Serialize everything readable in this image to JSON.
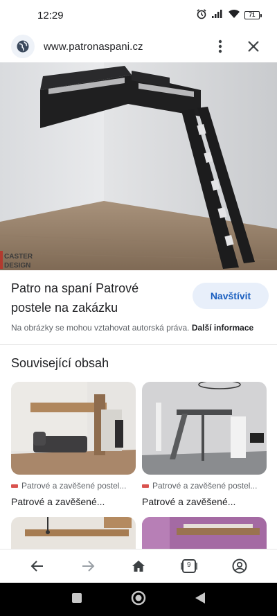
{
  "status_bar": {
    "time": "12:29",
    "battery": "71"
  },
  "header": {
    "url": "www.patronaspani.cz",
    "site_icon": "globe-icon",
    "more_icon": "more-vert-icon",
    "close_icon": "close-icon"
  },
  "hero": {
    "watermark_line1": "CASTER",
    "watermark_line2": "DESIGN"
  },
  "result": {
    "title": "Patro na spaní Patrové postele na zakázku",
    "visit_label": "Navštívit",
    "copyright_text": "Na obrázky se mohou vztahovat autorská práva.",
    "more_info_label": "Další informace"
  },
  "related": {
    "heading": "Související obsah",
    "cards": [
      {
        "source": "Patrové a zavěšené postel...",
        "title": "Patrové a zavěšené..."
      },
      {
        "source": "Patrové a zavěšené postel...",
        "title": "Patrové a zavěšené..."
      }
    ]
  },
  "bottom_nav": {
    "tab_count": "9"
  },
  "colors": {
    "accent": "#1a5fc0",
    "visit_bg": "#e8effa",
    "text": "#202124",
    "muted": "#5f6368"
  }
}
